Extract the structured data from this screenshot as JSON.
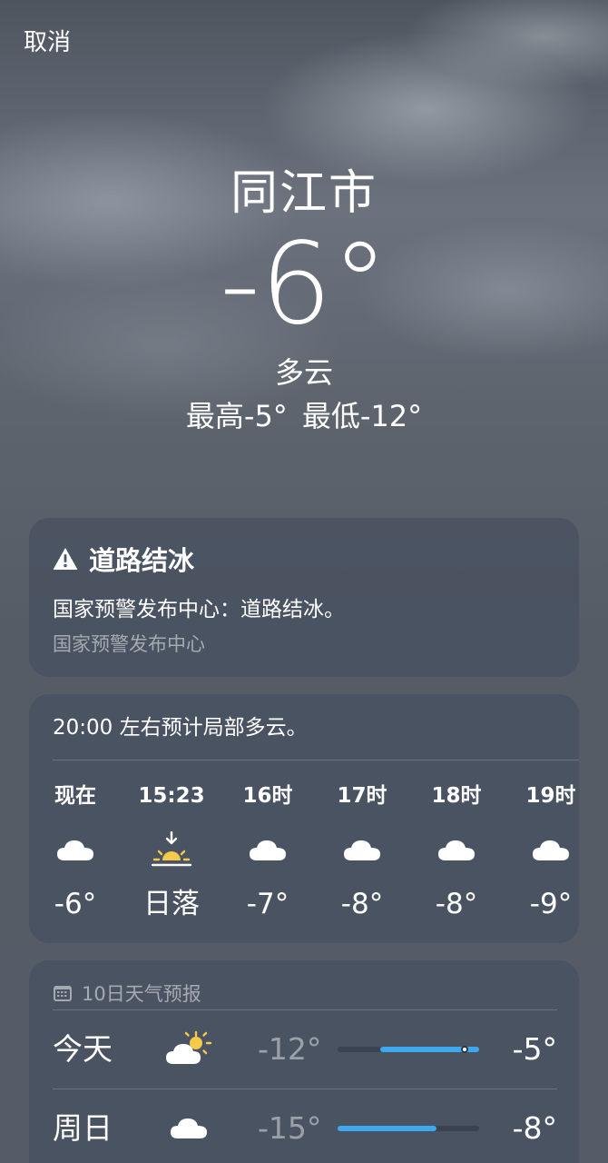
{
  "nav": {
    "cancel_label": "取消"
  },
  "current": {
    "city": "同江市",
    "temperature": "-6°",
    "condition": "多云",
    "high_label": "最高-5°",
    "low_label": "最低-12°"
  },
  "alert": {
    "icon": "warning-triangle-icon",
    "title": "道路结冰",
    "body": "国家预警发布中心：道路结冰。",
    "source": "国家预警发布中心"
  },
  "hourly": {
    "summary": "20:00 左右预计局部多云。",
    "items": [
      {
        "label": "现在",
        "icon": "cloud-icon",
        "temp": "-6°"
      },
      {
        "label": "15:23",
        "icon": "sunset-icon",
        "temp": "日落"
      },
      {
        "label": "16时",
        "icon": "cloud-icon",
        "temp": "-7°"
      },
      {
        "label": "17时",
        "icon": "cloud-icon",
        "temp": "-8°"
      },
      {
        "label": "18时",
        "icon": "cloud-icon",
        "temp": "-8°"
      },
      {
        "label": "19时",
        "icon": "cloud-icon",
        "temp": "-9°"
      }
    ]
  },
  "daily": {
    "header_icon": "calendar-icon",
    "header": "10日天气预报",
    "bar_color": "#3da8ee",
    "range_min": -15,
    "range_max": -5,
    "days": [
      {
        "name": "今天",
        "icon": "partly-sunny-icon",
        "low": "-12°",
        "high": "-5°",
        "low_value": -12,
        "high_value": -5,
        "current_value": -6
      },
      {
        "name": "周日",
        "icon": "cloud-icon",
        "low": "-15°",
        "high": "-8°",
        "low_value": -15,
        "high_value": -8
      }
    ]
  }
}
